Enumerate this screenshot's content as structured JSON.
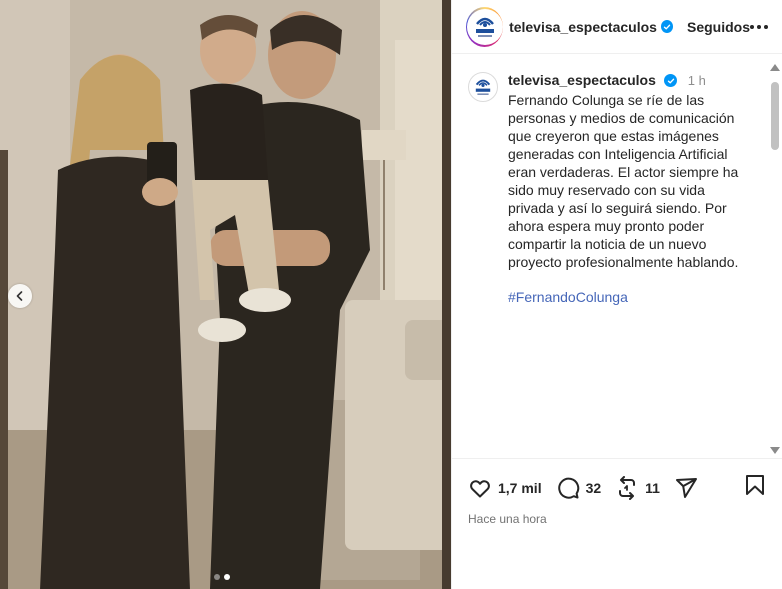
{
  "post": {
    "account": "televisa_espectaculos",
    "follow_status": "Seguidos",
    "posted_ago": "1 h",
    "caption": "Fernando Colunga se ríe de las personas y medios de comunicación que creyeron que estas imágenes generadas con Inteligencia Artificial eran verdaderas. El actor siempre ha sido muy reservado con su vida privada y así lo seguirá siendo. Por ahora espera muy pronto poder compartir la noticia de un nuevo proyecto profesionalmente hablando.",
    "hashtag": "#FernandoColunga",
    "likes": "1,7 mil",
    "comments": "32",
    "reposts": "11",
    "timestamp": "Hace una hora"
  },
  "logo": {
    "brand": "Televisa",
    "sub": "ESPECTÁCULOS"
  },
  "carousel": {
    "slide_count": 2,
    "active_index": 1
  },
  "colors": {
    "verified": "#0095f6",
    "hashtag": "#4566b8",
    "muted": "#737373",
    "text": "#262626"
  },
  "icons": [
    "heart-icon",
    "comment-icon",
    "repost-icon",
    "share-icon",
    "bookmark-icon",
    "chevron-left-icon",
    "more-icon",
    "verified-icon"
  ]
}
